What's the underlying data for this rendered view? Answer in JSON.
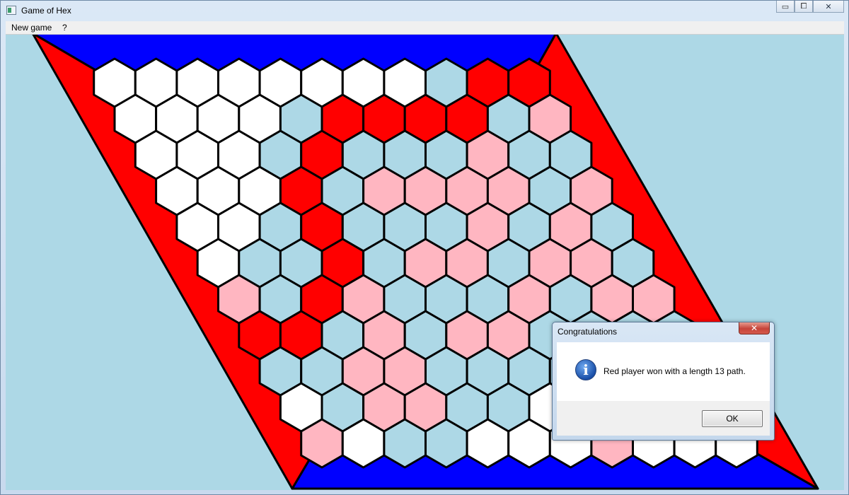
{
  "window": {
    "title": "Game of Hex",
    "icon": "app-window-icon"
  },
  "caption_buttons": {
    "minimize": "▭",
    "maximize": "⧠",
    "close": "✕"
  },
  "menu": {
    "items": [
      "New game",
      "?"
    ]
  },
  "colors": {
    "background": "#add8e6",
    "red_edge": "#ff0000",
    "blue_edge": "#0000ff",
    "empty_cell": "#ffffff",
    "red_stone": "#ff0000",
    "pink_cell": "#ffb6c1",
    "lightblue_cell": "#add8e6",
    "cell_border": "#000000"
  },
  "board": {
    "size": 11,
    "legend": {
      "W": "empty",
      "R": "red stone (winning path)",
      "P": "pink (red-side region)",
      "B": "light blue (blue-side region)"
    },
    "rows": [
      "WWWWWWWWBRR",
      "WWWWBRRRRBP",
      "WWWBRBBBPBB",
      "WWWRBPPPPBP",
      "WWBRBBBPBPB",
      "WBBRBPPBPPB",
      "PBRPBBBPBPP",
      "RRBPBPPBBBB",
      "BBPPBBBBBBB",
      "WBPPBBWBBWW",
      "PWBBWWWPWWW"
    ]
  },
  "dialog": {
    "title": "Congratulations",
    "close_glyph": "✕",
    "message": "Red player won with a length 13 path.",
    "icon": "information-icon",
    "icon_glyph": "i",
    "ok_label": "OK"
  }
}
